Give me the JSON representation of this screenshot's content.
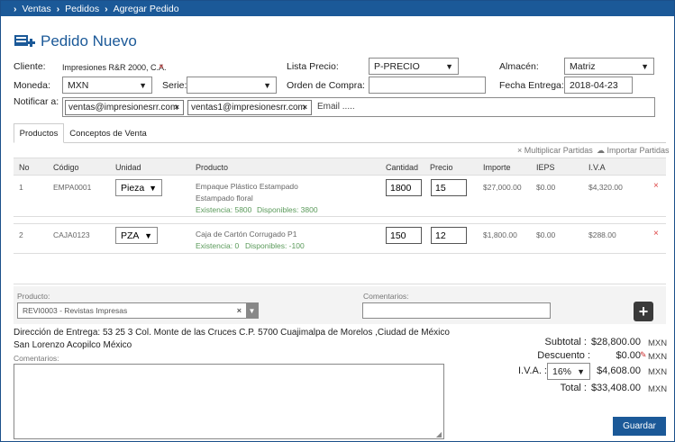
{
  "breadcrumb": [
    "Ventas",
    "Pedidos",
    "Agregar Pedido"
  ],
  "page_title": "Pedido Nuevo",
  "form": {
    "cliente_label": "Cliente:",
    "cliente_value": "Impresiones R&R 2000, C.A.",
    "lista_precio_label": "Lista Precio:",
    "lista_precio_value": "P-PRECIO",
    "almacen_label": "Almacén:",
    "almacen_value": "Matriz",
    "moneda_label": "Moneda:",
    "moneda_value": "MXN",
    "serie_label": "Serie:",
    "serie_value": "",
    "orden_label": "Orden de Compra:",
    "orden_value": "",
    "fecha_label": "Fecha Entrega:",
    "fecha_value": "2018-04-23",
    "notificar_label": "Notificar a:",
    "emails": [
      "ventas@impresionesrr.com",
      "ventas1@impresionesrr.com"
    ],
    "email_placeholder": "Email ....."
  },
  "tabs": [
    "Productos",
    "Conceptos de Venta"
  ],
  "actions": {
    "multiplicar": "Multiplicar Partidas",
    "importar": "Importar Partidas"
  },
  "table": {
    "headers": [
      "No",
      "Código",
      "Unidad",
      "Producto",
      "Cantidad",
      "Precio",
      "Importe",
      "IEPS",
      "I.V.A"
    ],
    "rows": [
      {
        "no": "1",
        "codigo": "EMPA0001",
        "unidad": "Pieza",
        "producto": "Empaque Plástico Estampado",
        "descripcion": "Estampado floral",
        "existencia": "Existencia: 5800",
        "disponibles": "Disponibles: 3800",
        "cantidad": "1800",
        "precio": "15",
        "importe": "$27,000.00",
        "ieps": "$0.00",
        "iva": "$4,320.00"
      },
      {
        "no": "2",
        "codigo": "CAJA0123",
        "unidad": "PZA",
        "producto": "Caja de Cartón Corrugado P1",
        "descripcion": "",
        "existencia": "Existencia: 0",
        "disponibles": "Disponibles: -100",
        "cantidad": "150",
        "precio": "12",
        "importe": "$1,800.00",
        "ieps": "$0.00",
        "iva": "$288.00"
      }
    ]
  },
  "add": {
    "producto_label": "Producto:",
    "producto_value": "REVI0003 - Revistas Impresas",
    "comentarios_label": "Comentarios:"
  },
  "direccion": {
    "line1": "Dirección de Entrega: 53 25 3 Col. Monte de las Cruces C.P. 5700 Cuajimalpa de Morelos ,Ciudad de México",
    "line2": "San Lorenzo Acopilco México",
    "comentarios_label": "Comentarios:"
  },
  "totals": {
    "subtotal_label": "Subtotal :",
    "subtotal_value": "$28,800.00",
    "descuento_label": "Descuento :",
    "descuento_value": "$0.00",
    "iva_label": "I.V.A. :",
    "iva_rate": "16%",
    "iva_value": "$4,608.00",
    "total_label": "Total :",
    "total_value": "$33,408.00",
    "currency": "MXN"
  },
  "save_label": "Guardar"
}
